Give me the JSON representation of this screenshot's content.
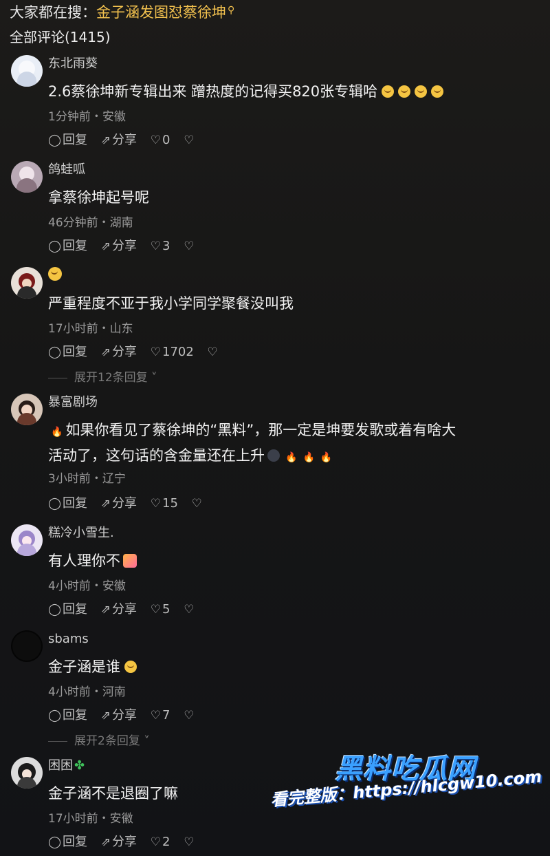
{
  "search": {
    "prefix": "大家都在搜：",
    "keyword": "金子涵发图怼蔡徐坤"
  },
  "comments_header": {
    "title": "全部评论(1415)"
  },
  "comments": [
    {
      "user": "东北雨葵",
      "text": "2.6蔡徐坤新专辑出来 蹭热度的记得买820张专辑哈",
      "meta": "1分钟前・安徽",
      "reply": "回复",
      "share": "分享",
      "likes": "0"
    },
    {
      "user": "鸽蛙呱",
      "text": "拿蔡徐坤起号呢",
      "meta": "46分钟前・湖南",
      "reply": "回复",
      "share": "分享",
      "likes": "3"
    },
    {
      "user": "",
      "text": "严重程度不亚于我小学同学聚餐没叫我",
      "meta": "17小时前・山东",
      "reply": "回复",
      "share": "分享",
      "likes": "1702"
    },
    {
      "user": "暴富剧场",
      "text_line1": "如果你看见了蔡徐坤的“黑料”，那一定是坤要发歌或着有啥大",
      "text_line2": "活动了，这句话的含金量还在上升",
      "meta": "3小时前・辽宁",
      "reply": "回复",
      "share": "分享",
      "likes": "15"
    },
    {
      "user": "糕冷小雪生.",
      "text": "有人理你不",
      "meta": "4小时前・安徽",
      "reply": "回复",
      "share": "分享",
      "likes": "5"
    },
    {
      "user": "sbams",
      "text": "金子涵是谁",
      "meta": "4小时前・河南",
      "reply": "回复",
      "share": "分享",
      "likes": "7"
    },
    {
      "user": "困困",
      "text": "金子涵不是退圈了嘛",
      "meta": "17小时前・安徽",
      "reply": "回复",
      "share": "分享",
      "likes": "2"
    }
  ],
  "expand": [
    "展开12条回复",
    "展开2条回复"
  ],
  "watermark": {
    "title": "黑料吃瓜网",
    "url": "看完整版：https://hlcgw10.com"
  }
}
